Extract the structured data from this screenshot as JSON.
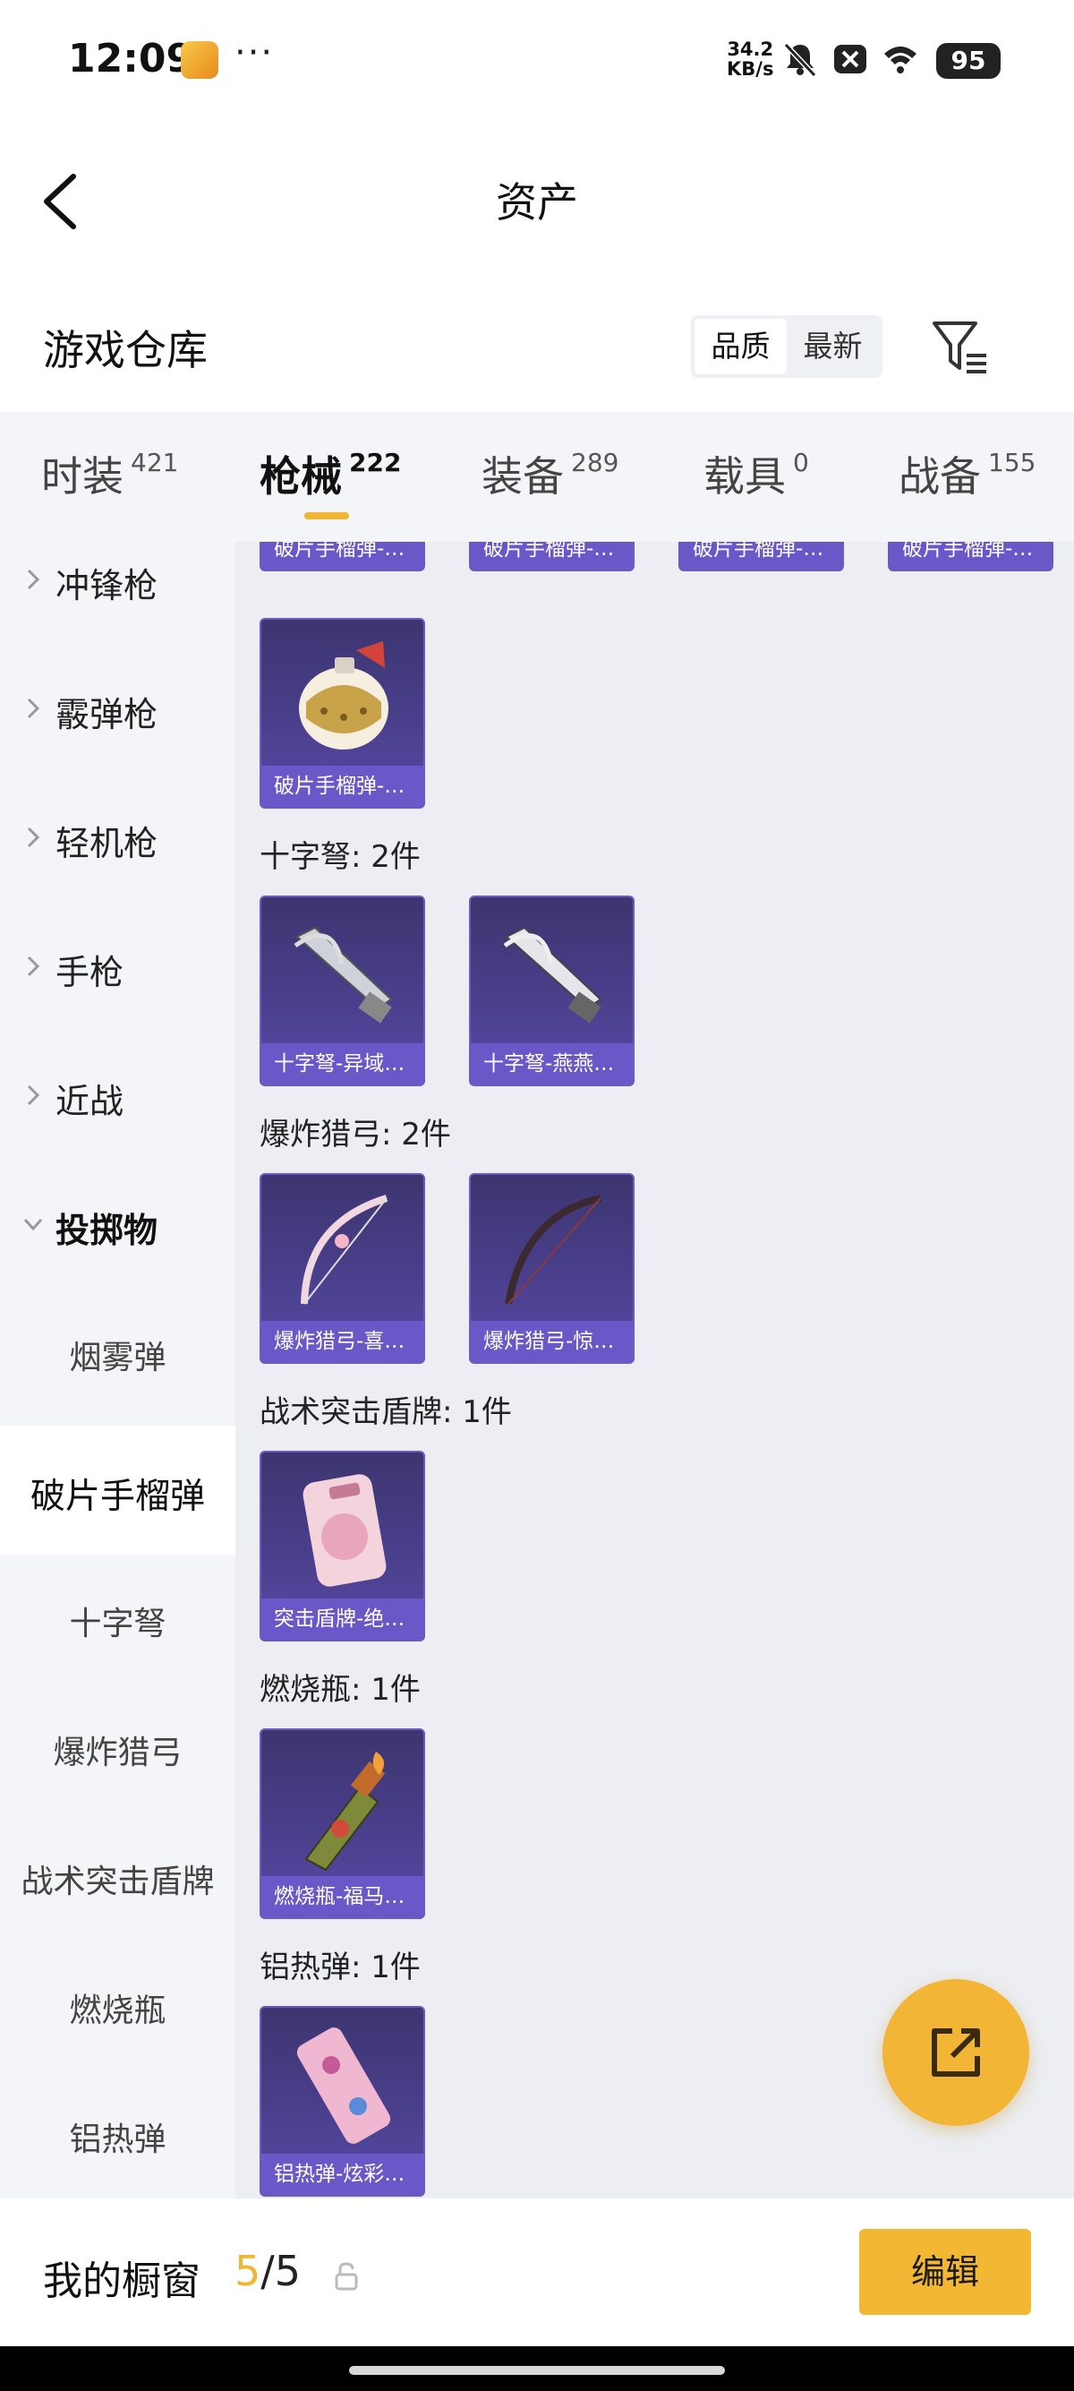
{
  "status_bar": {
    "time": "12:09",
    "dots": "···",
    "speed_value": "34.2",
    "speed_unit": "KB/s",
    "battery": "95"
  },
  "title_bar": {
    "title": "资产"
  },
  "header": {
    "section_title": "游戏仓库",
    "sort_options": [
      "品质",
      "最新"
    ],
    "sort_selected": "品质"
  },
  "tabs": [
    {
      "label": "时装",
      "count": "421"
    },
    {
      "label": "枪械",
      "count": "222",
      "active": true
    },
    {
      "label": "装备",
      "count": "289"
    },
    {
      "label": "载具",
      "count": "0"
    },
    {
      "label": "战备",
      "count": "155"
    }
  ],
  "sidebar": {
    "items": [
      {
        "label": "冲锋枪",
        "type": "parent"
      },
      {
        "label": "霰弹枪",
        "type": "parent"
      },
      {
        "label": "轻机枪",
        "type": "parent"
      },
      {
        "label": "手枪",
        "type": "parent"
      },
      {
        "label": "近战",
        "type": "parent"
      },
      {
        "label": "投掷物",
        "type": "expanded"
      },
      {
        "label": "烟雾弹",
        "type": "sub"
      },
      {
        "label": "破片手榴弹",
        "type": "sub",
        "selected": true
      },
      {
        "label": "十字弩",
        "type": "sub"
      },
      {
        "label": "爆炸猎弓",
        "type": "sub"
      },
      {
        "label": "战术突击盾牌",
        "type": "sub"
      },
      {
        "label": "燃烧瓶",
        "type": "sub"
      },
      {
        "label": "铝热弹",
        "type": "sub"
      }
    ]
  },
  "content": {
    "partial_row": [
      "破片手榴弹-…",
      "破片手榴弹-…",
      "破片手榴弹-…",
      "破片手榴弹-…"
    ],
    "grenade_single": "破片手榴弹-…",
    "groups": [
      {
        "title": "十字弩: 2件",
        "items": [
          "十字弩-异域…",
          "十字弩-燕燕…"
        ]
      },
      {
        "title": "爆炸猎弓: 2件",
        "items": [
          "爆炸猎弓-喜…",
          "爆炸猎弓-惊…"
        ]
      },
      {
        "title": "战术突击盾牌: 1件",
        "items": [
          "突击盾牌-绝…"
        ]
      },
      {
        "title": "燃烧瓶: 1件",
        "items": [
          "燃烧瓶-福马…"
        ]
      },
      {
        "title": "铝热弹: 1件",
        "items": [
          "铝热弹-炫彩…"
        ]
      }
    ]
  },
  "bottom_bar": {
    "title": "我的橱窗",
    "count_current": "5",
    "count_total": "/5",
    "edit_label": "编辑"
  },
  "colors": {
    "accent": "#f2b733",
    "card_bg": "#4a3f8c",
    "card_caption": "#6a58c8"
  }
}
